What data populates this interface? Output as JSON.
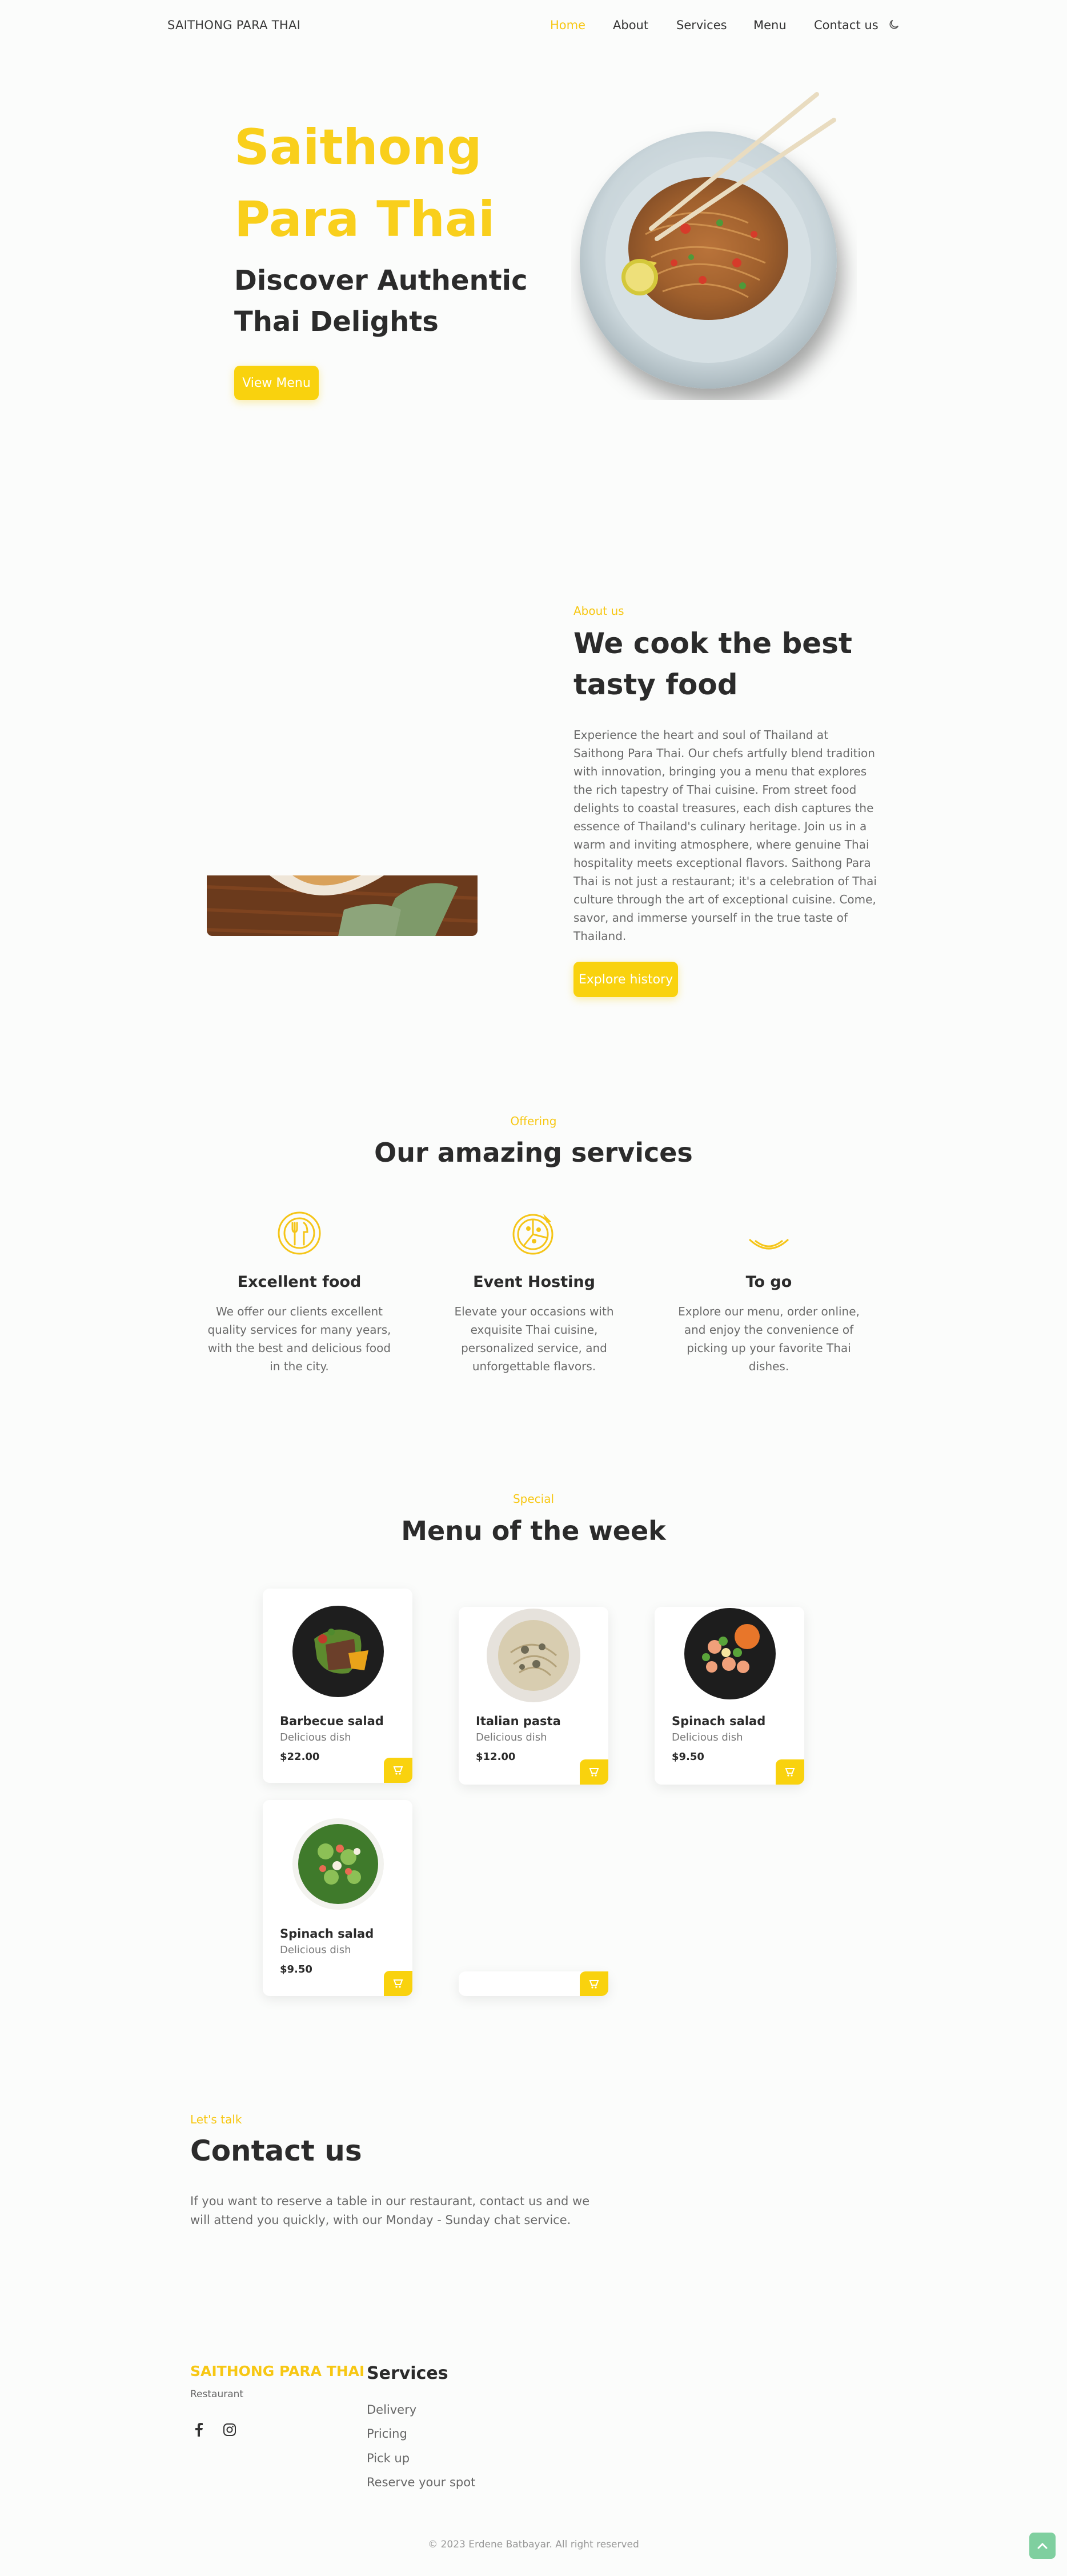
{
  "header": {
    "brand": "SAITHONG PARA THAI",
    "nav": [
      "Home",
      "About",
      "Services",
      "Menu",
      "Contact us"
    ],
    "theme_icon": "moon-icon"
  },
  "hero": {
    "title_line1": "Saithong",
    "title_line2": "Para Thai",
    "subtitle": "Discover Authentic Thai Delights",
    "button": "View Menu",
    "image": "pad-thai-plate"
  },
  "about": {
    "label": "About us",
    "heading": "We cook the best tasty food",
    "text": "Experience the heart and soul of Thailand at Saithong Para Thai. Our chefs artfully blend tradition with innovation, bringing you a menu that explores the rich tapestry of Thai cuisine. From street food delights to coastal treasures, each dish captures the essence of Thailand's culinary heritage. Join us in a warm and inviting atmosphere, where genuine Thai hospitality meets exceptional flavors. Saithong Para Thai is not just a restaurant; it's a celebration of Thai culture through the art of exceptional cuisine. Come, savor, and immerse yourself in the true taste of Thailand.",
    "button": "Explore history"
  },
  "services": {
    "label": "Offering",
    "heading": "Our amazing services",
    "items": [
      {
        "title": "Excellent food",
        "text": "We offer our clients excellent quality services for many years, with the best and delicious food in the city.",
        "icon": "plate-cutlery-icon"
      },
      {
        "title": "Event Hosting",
        "text": "Elevate your occasions with exquisite Thai cuisine, personalized service, and unforgettable flavors.",
        "icon": "pizza-icon"
      },
      {
        "title": "To go",
        "text": "Explore our menu, order online, and enjoy the convenience of picking up your favorite Thai dishes.",
        "icon": "takeaway-icon"
      }
    ]
  },
  "menu": {
    "label": "Special",
    "heading": "Menu of the week",
    "items": [
      {
        "name": "Barbecue salad",
        "desc": "Delicious dish",
        "price": "$22.00"
      },
      {
        "name": "Italian pasta",
        "desc": "Delicious dish",
        "price": "$12.00"
      },
      {
        "name": "Spinach salad",
        "desc": "Delicious dish",
        "price": "$9.50"
      },
      {
        "name": "Spinach salad",
        "desc": "Delicious dish",
        "price": "$9.50"
      }
    ],
    "cart_icon": "cart-icon"
  },
  "contact": {
    "label": "Let's talk",
    "heading": "Contact us",
    "text": "If you want to reserve a table in our restaurant, contact us and we will attend you quickly, with our Monday - Sunday chat service."
  },
  "footer": {
    "brand": "SAITHONG PARA THAI",
    "sub": "Restaurant",
    "services_heading": "Services",
    "links": [
      "Delivery",
      "Pricing",
      "Pick up",
      "Reserve your spot"
    ],
    "copyright": "© 2023 Erdene Batbayar. All right reserved",
    "social_icons": [
      "facebook-icon",
      "instagram-icon"
    ]
  },
  "colors": {
    "accent": "#f9d20e",
    "scrollup": "#7fcf9f"
  }
}
